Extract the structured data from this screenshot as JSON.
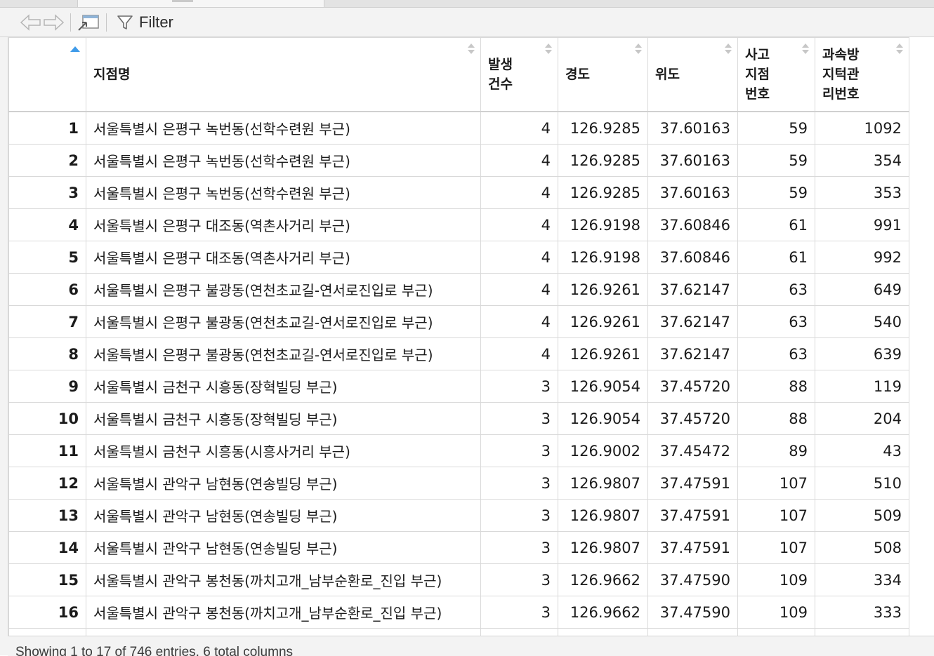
{
  "toolbar": {
    "filter_label": "Filter"
  },
  "columns": [
    "",
    "지점명",
    "발생건수",
    "경도",
    "위도",
    "사고지점번호",
    "과속방지턱관리번호"
  ],
  "rows": [
    [
      "1",
      "서울특별시 은평구 녹번동(선학수련원 부근)",
      "4",
      "126.9285",
      "37.60163",
      "59",
      "1092"
    ],
    [
      "2",
      "서울특별시 은평구 녹번동(선학수련원 부근)",
      "4",
      "126.9285",
      "37.60163",
      "59",
      "354"
    ],
    [
      "3",
      "서울특별시 은평구 녹번동(선학수련원 부근)",
      "4",
      "126.9285",
      "37.60163",
      "59",
      "353"
    ],
    [
      "4",
      "서울특별시 은평구 대조동(역촌사거리 부근)",
      "4",
      "126.9198",
      "37.60846",
      "61",
      "991"
    ],
    [
      "5",
      "서울특별시 은평구 대조동(역촌사거리 부근)",
      "4",
      "126.9198",
      "37.60846",
      "61",
      "992"
    ],
    [
      "6",
      "서울특별시 은평구 불광동(연천초교길-연서로진입로 부근)",
      "4",
      "126.9261",
      "37.62147",
      "63",
      "649"
    ],
    [
      "7",
      "서울특별시 은평구 불광동(연천초교길-연서로진입로 부근)",
      "4",
      "126.9261",
      "37.62147",
      "63",
      "540"
    ],
    [
      "8",
      "서울특별시 은평구 불광동(연천초교길-연서로진입로 부근)",
      "4",
      "126.9261",
      "37.62147",
      "63",
      "639"
    ],
    [
      "9",
      "서울특별시 금천구 시흥동(장혁빌딩 부근)",
      "3",
      "126.9054",
      "37.45720",
      "88",
      "119"
    ],
    [
      "10",
      "서울특별시 금천구 시흥동(장혁빌딩 부근)",
      "3",
      "126.9054",
      "37.45720",
      "88",
      "204"
    ],
    [
      "11",
      "서울특별시 금천구 시흥동(시흥사거리 부근)",
      "3",
      "126.9002",
      "37.45472",
      "89",
      "43"
    ],
    [
      "12",
      "서울특별시 관악구 남현동(연송빌딩 부근)",
      "3",
      "126.9807",
      "37.47591",
      "107",
      "510"
    ],
    [
      "13",
      "서울특별시 관악구 남현동(연송빌딩 부근)",
      "3",
      "126.9807",
      "37.47591",
      "107",
      "509"
    ],
    [
      "14",
      "서울특별시 관악구 남현동(연송빌딩 부근)",
      "3",
      "126.9807",
      "37.47591",
      "107",
      "508"
    ],
    [
      "15",
      "서울특별시 관악구 봉천동(까치고개_남부순환로_진입 부근)",
      "3",
      "126.9662",
      "37.47590",
      "109",
      "334"
    ],
    [
      "16",
      "서울특별시 관악구 봉천동(까치고개_남부순환로_진입 부근)",
      "3",
      "126.9662",
      "37.47590",
      "109",
      "333"
    ]
  ],
  "status": {
    "text": "Showing 1 to 17 of 746 entries, 6 total columns"
  },
  "icons": [
    "back-arrow-icon",
    "forward-arrow-icon",
    "open-in-window-icon",
    "filter-icon"
  ],
  "colors": {
    "sort_active": "#3f9be9",
    "sort_inactive": "#c7c7c7"
  }
}
